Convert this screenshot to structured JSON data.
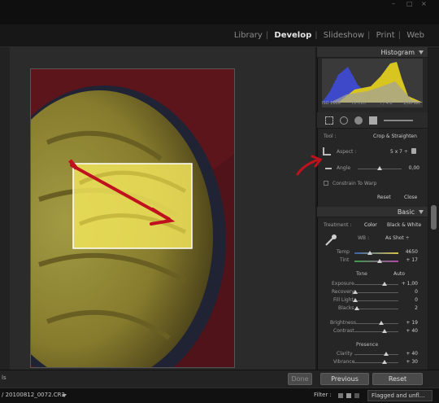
{
  "window": {
    "controls": [
      "–",
      "□",
      "×"
    ]
  },
  "modules": {
    "items": [
      "Library",
      "Develop",
      "Slideshow",
      "Print",
      "Web"
    ],
    "active": "Develop"
  },
  "histogram": {
    "title": "Histogram",
    "iso": "ISO 1600",
    "focal": "70 mm",
    "aperture": "f / 4.0",
    "shutter": "1/60 sec"
  },
  "tool": {
    "tool_label": "Tool :",
    "tool_value": "Crop & Straighten",
    "aspect_label": "Aspect :",
    "aspect_value": "5 x 7 ÷",
    "angle_label": "Angle",
    "angle_value": "0,00",
    "constrain_label": "Constrain To Warp",
    "reset": "Reset",
    "close": "Close"
  },
  "basic": {
    "title": "Basic",
    "treatment_label": "Treatment :",
    "color": "Color",
    "bw": "Black & White",
    "wb_label": "WB :",
    "wb_value": "As Shot ÷",
    "temp_label": "Temp",
    "temp_value": "4650",
    "tint_label": "Tint",
    "tint_value": "+ 17",
    "tone_label": "Tone",
    "auto": "Auto",
    "exposure_label": "Exposure",
    "exposure_value": "+ 1,00",
    "recovery_label": "Recovery",
    "recovery_value": "0",
    "filllight_label": "Fill Light",
    "filllight_value": "0",
    "blacks_label": "Blacks",
    "blacks_value": "2",
    "brightness_label": "Brightness",
    "brightness_value": "+ 19",
    "contrast_label": "Contrast",
    "contrast_value": "+ 40",
    "presence_label": "Presence",
    "clarity_label": "Clarity",
    "clarity_value": "+ 40",
    "vibrance_label": "Vibrance",
    "vibrance_value": "+ 30"
  },
  "bottom": {
    "left_text": "ls",
    "done": "Done",
    "previous": "Previous",
    "reset": "Reset"
  },
  "filmstrip": {
    "file": "/ 20100812_0072.CR2",
    "filter": "Filter :",
    "flagged": "Flagged and unfl..."
  },
  "colors": {
    "annotation": "#c0121e",
    "photo_bg": "#7a1a22",
    "panel": "#262626"
  }
}
